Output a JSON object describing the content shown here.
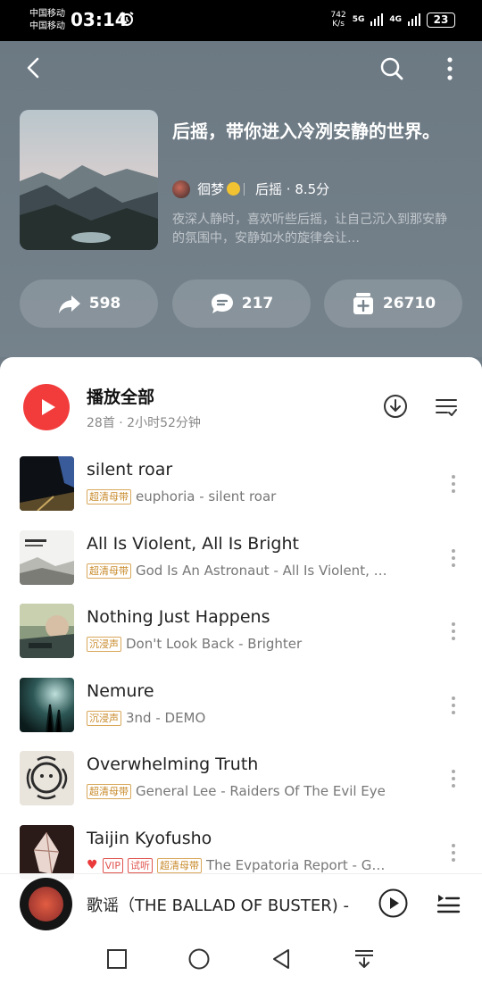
{
  "status_bar": {
    "carrier1": "中国移动",
    "carrier2": "中国移动",
    "time": "03:14",
    "speed_value": "742",
    "speed_unit": "K/s",
    "net1": "5G",
    "net2": "4G",
    "battery": "23"
  },
  "playlist": {
    "title": "后摇，带你进入冷冽安静的世界。",
    "creator": "徊梦",
    "genre_score": "后摇 · 8.5分",
    "description": "夜深人静时，喜欢听些后摇，让自己沉入到那安静的氛围中，安静如水的旋律会让…"
  },
  "actions": {
    "share_count": "598",
    "comment_count": "217",
    "collect_count": "26710"
  },
  "list_header": {
    "play_all": "播放全部",
    "meta": "28首 · 2小时52分钟"
  },
  "songs": [
    {
      "title": "silent roar",
      "tags": [
        "超清母带"
      ],
      "subtitle": "euphoria - silent roar"
    },
    {
      "title": "All Is Violent, All Is Bright",
      "tags": [
        "超清母带"
      ],
      "subtitle": "God Is An Astronaut - All Is Violent, …"
    },
    {
      "title": "Nothing Just Happens",
      "tags": [
        "沉浸声"
      ],
      "subtitle": "Don't Look Back - Brighter"
    },
    {
      "title": "Nemure",
      "tags": [
        "沉浸声"
      ],
      "subtitle": "3nd - DEMO"
    },
    {
      "title": "Overwhelming Truth",
      "tags": [
        "超清母带"
      ],
      "subtitle": "General Lee - Raiders Of The Evil Eye"
    },
    {
      "title": "Taijin Kyofusho",
      "tags": [
        "VIP",
        "试听",
        "超清母带"
      ],
      "subtitle": "The Evpatoria Report - G…"
    }
  ],
  "now_playing": {
    "title": "歌谣（THE BALLAD OF BUSTER) -"
  },
  "colors": {
    "accent_red": "#f23c3c",
    "header_bg": "#6f7c86",
    "tag_gold": "#c88a2a"
  }
}
